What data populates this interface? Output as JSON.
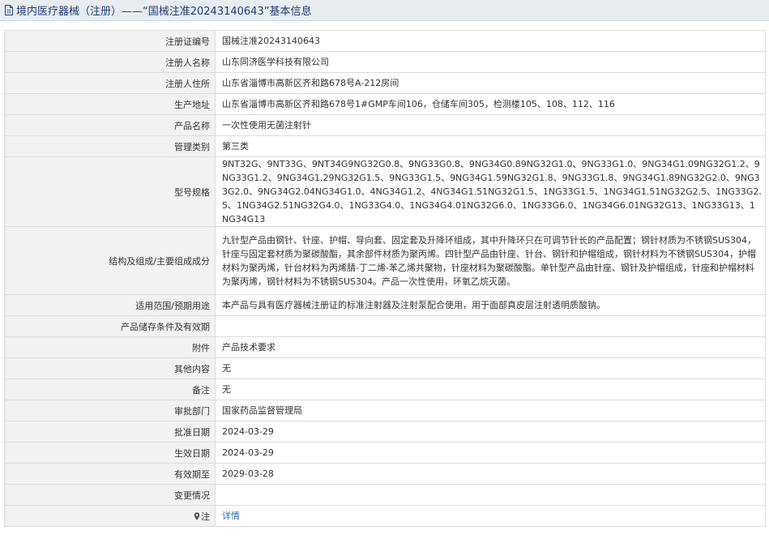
{
  "header": {
    "title": "境内医疗器械（注册）——“国械注准20243140643”基本信息"
  },
  "rows": [
    {
      "label": "注册证编号",
      "value": "国械注准20243140643"
    },
    {
      "label": "注册人名称",
      "value": "山东同济医学科技有限公司"
    },
    {
      "label": "注册人住所",
      "value": "山东省淄博市高新区齐和路678号A-212房间"
    },
    {
      "label": "生产地址",
      "value": "山东省淄博市高新区齐和路678号1#GMP车间106，仓储车间305，检测楼105、108、112、116"
    },
    {
      "label": "产品名称",
      "value": "一次性使用无菌注射针"
    },
    {
      "label": "管理类别",
      "value": "第三类"
    },
    {
      "label": "型号规格",
      "value": "9NT32G、9NT33G、9NT34G9NG32G0.8、9NG33G0.8、9NG34G0.89NG32G1.0、9NG33G1.0、9NG34G1.09NG32G1.2、9NG33G1.2、9NG34G1.29NG32G1.5、9NG33G1.5、9NG34G1.59NG32G1.8、9NG33G1.8、9NG34G1.89NG32G2.0、9NG33G2.0、9NG34G2.04NG34G1.0、4NG34G1.2、4NG34G1.51NG32G1.5、1NG33G1.5、1NG34G1.51NG32G2.5、1NG33G2.5、1NG34G2.51NG32G4.0、1NG33G4.0、1NG34G4.01NG32G6.0、1NG33G6.0、1NG34G6.01NG32G13、1NG33G13、1NG34G13"
    },
    {
      "label": "结构及组成/主要组成成分",
      "value": "九针型产品由钢针、针座、护帽、导向套、固定套及升降环组成，其中升降环只在可调节针长的产品配置；钢针材质为不锈钢SUS304，针座与固定套材质为聚碳酸酯，其余部件材质为聚丙烯。四针型产品由针座、针台、钢针和护帽组成，钢针材料为不锈钢SUS304，护帽材料为聚丙烯，针台材料为丙烯腈-丁二烯-苯乙烯共聚物，针座材料为聚碳酸酯。单针型产品由针座、钢针及护帽组成，针座和护帽材料为聚丙烯，钢针材料为不锈钢SUS304。产品一次性使用，环氧乙烷灭菌。"
    },
    {
      "label": "适用范围/预期用途",
      "value": "本产品与具有医疗器械注册证的标准注射器及注射泵配合使用，用于面部真皮层注射透明质酸钠。"
    },
    {
      "label": "产品储存条件及有效期",
      "value": ""
    },
    {
      "label": "附件",
      "value": "产品技术要求"
    },
    {
      "label": "其他内容",
      "value": "无"
    },
    {
      "label": "备注",
      "value": "无"
    },
    {
      "label": "审批部门",
      "value": "国家药品监督管理局"
    },
    {
      "label": "批准日期",
      "value": "2024-03-29"
    },
    {
      "label": "生效日期",
      "value": "2024-03-29"
    },
    {
      "label": "有效期至",
      "value": "2029-03-28"
    },
    {
      "label": "变更情况",
      "value": ""
    }
  ],
  "note": {
    "label": "注",
    "link": "详情",
    "icon": "map-pin-icon"
  },
  "colors": {
    "header_bg": "#e9ecf0",
    "header_text": "#1f3d7a",
    "label_bg": "#f2f2f2",
    "link": "#2a6bb6"
  }
}
